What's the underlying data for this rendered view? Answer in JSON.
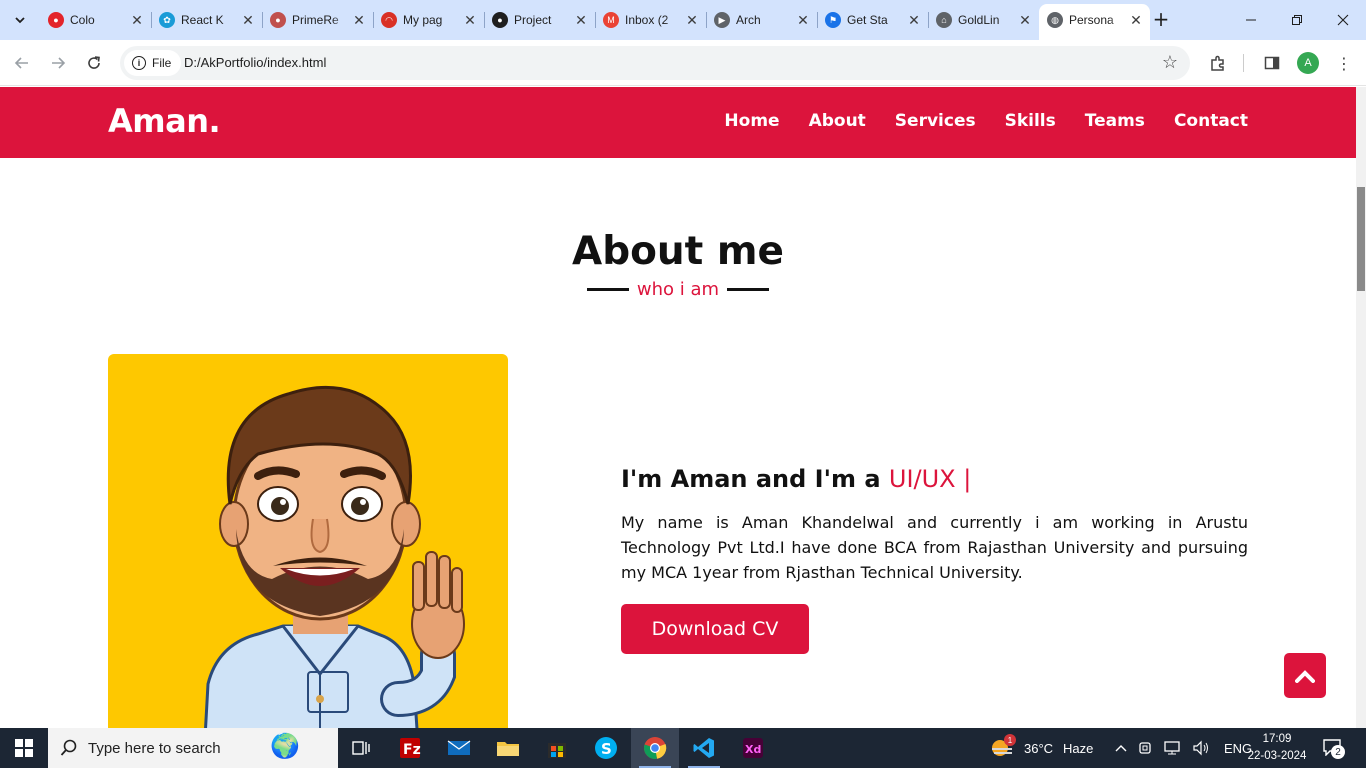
{
  "browser": {
    "tabs": [
      {
        "title": "Colo",
        "fav_color": "#e3242b",
        "fav_glyph": "●"
      },
      {
        "title": "React K",
        "fav_color": "#1a9bd7",
        "fav_glyph": "✿"
      },
      {
        "title": "PrimeRe",
        "fav_color": "#c0504d",
        "fav_glyph": "●"
      },
      {
        "title": "My pag",
        "fav_color": "#d93025",
        "fav_glyph": "◠"
      },
      {
        "title": "Project",
        "fav_color": "#1f1f1f",
        "fav_glyph": "●"
      },
      {
        "title": "Inbox (2",
        "fav_color": "#ea4335",
        "fav_glyph": "M"
      },
      {
        "title": "Arch",
        "fav_color": "#5f6368",
        "fav_glyph": "▶"
      },
      {
        "title": "Get Sta",
        "fav_color": "#1a73e8",
        "fav_glyph": "⚑"
      },
      {
        "title": "GoldLin",
        "fav_color": "#5f6368",
        "fav_glyph": "⌂"
      },
      {
        "title": "Persona",
        "fav_color": "#5f6368",
        "fav_glyph": "◍"
      }
    ],
    "address_chip": "File",
    "url": "D:/AkPortfolio/index.html",
    "profile_initial": "A"
  },
  "site": {
    "brand": "Aman.",
    "nav": [
      "Home",
      "About",
      "Services",
      "Skills",
      "Teams",
      "Contact"
    ],
    "section_title": "About me",
    "section_subtitle": "who i am",
    "heading_prefix": "I'm Aman and I'm a ",
    "heading_typed": "UI/UX |",
    "about_text": "My name is Aman Khandelwal and currently i am working in Arustu Technology Pvt Ltd.I have done BCA from Rajasthan University and pursuing my MCA 1year from Rjasthan Technical University.",
    "cv_button": "Download CV",
    "accent_color": "#dc143c",
    "photo_bg": "#fec800"
  },
  "taskbar": {
    "search_placeholder": "Type here to search",
    "weather_temp": "36°C",
    "weather_text": "Haze",
    "weather_badge": "1",
    "language": "ENG",
    "time": "17:09",
    "date": "22-03-2024",
    "notifications": "2"
  }
}
